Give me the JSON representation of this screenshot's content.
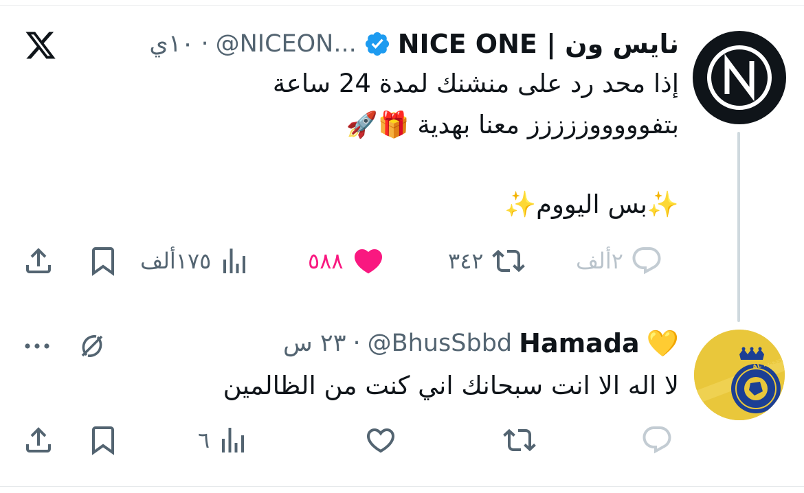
{
  "brand": {
    "x_logo": "x-logo-icon"
  },
  "tweet": {
    "display_name": "نايس ون | NICE ONE",
    "verified_color": "#1d9bf0",
    "handle": "@NICEON...",
    "separator": "·",
    "time": "١٠ي",
    "lines": [
      "إذا محد رد على منشنك لمدة 24 ساعة",
      "بتفوووووززززز معنا بهدية 🎁🚀",
      "✨بس اليووم✨"
    ],
    "actions": {
      "reply_count": "٢ألف",
      "retweet_count": "٣٤٢",
      "like_count": "٥٨٨",
      "views_count": "١٧٥ألف"
    }
  },
  "reply": {
    "display_name": "Hamada",
    "emoji": "💛",
    "handle": "@BhusSbbd",
    "separator": "·",
    "time": "٢٣ س",
    "text": "لا اله الا انت سبحانك اني كنت من الظالمين",
    "actions": {
      "views_count": "٦"
    }
  },
  "colors": {
    "like_pink": "#f91880",
    "icon_gray": "#536471",
    "faint_gray": "#b9c3cb"
  }
}
